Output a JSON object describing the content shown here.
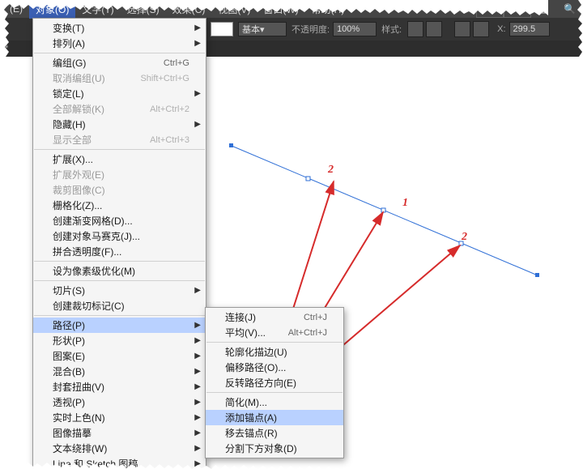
{
  "menubar": {
    "items": [
      {
        "label": "(E)"
      },
      {
        "label": "对象(O)"
      },
      {
        "label": "文字(T)"
      },
      {
        "label": "选择(S)"
      },
      {
        "label": "效果(C)"
      },
      {
        "label": "视图(V)"
      },
      {
        "label": "窗口(W)"
      },
      {
        "label": "帮助(H)"
      }
    ],
    "active_index": 1
  },
  "toolbar": {
    "basic_label": "基本",
    "opacity_label": "不透明度:",
    "opacity_value": "100%",
    "style_label": "样式:",
    "x_label": "X:",
    "x_value": "299.5"
  },
  "tabstrip": {
    "doc_label": "*"
  },
  "object_menu": [
    {
      "label": "变换(T)",
      "arrow": true
    },
    {
      "label": "排列(A)",
      "arrow": true
    },
    {
      "sep": true
    },
    {
      "label": "编组(G)",
      "shortcut": "Ctrl+G"
    },
    {
      "label": "取消编组(U)",
      "shortcut": "Shift+Ctrl+G",
      "disabled": true
    },
    {
      "label": "锁定(L)",
      "arrow": true
    },
    {
      "label": "全部解锁(K)",
      "shortcut": "Alt+Ctrl+2",
      "disabled": true
    },
    {
      "label": "隐藏(H)",
      "arrow": true
    },
    {
      "label": "显示全部",
      "shortcut": "Alt+Ctrl+3",
      "disabled": true
    },
    {
      "sep": true
    },
    {
      "label": "扩展(X)..."
    },
    {
      "label": "扩展外观(E)",
      "disabled": true
    },
    {
      "label": "裁剪图像(C)",
      "disabled": true
    },
    {
      "label": "栅格化(Z)..."
    },
    {
      "label": "创建渐变网格(D)..."
    },
    {
      "label": "创建对象马赛克(J)..."
    },
    {
      "label": "拼合透明度(F)..."
    },
    {
      "sep": true
    },
    {
      "label": "设为像素级优化(M)"
    },
    {
      "sep": true
    },
    {
      "label": "切片(S)",
      "arrow": true
    },
    {
      "label": "创建裁切标记(C)"
    },
    {
      "sep": true
    },
    {
      "label": "路径(P)",
      "arrow": true,
      "highlight": true
    },
    {
      "label": "形状(P)",
      "arrow": true
    },
    {
      "label": "图案(E)",
      "arrow": true
    },
    {
      "label": "混合(B)",
      "arrow": true
    },
    {
      "label": "封套扭曲(V)",
      "arrow": true
    },
    {
      "label": "透视(P)",
      "arrow": true
    },
    {
      "label": "实时上色(N)",
      "arrow": true
    },
    {
      "label": "图像描摹",
      "arrow": true
    },
    {
      "label": "文本绕排(W)",
      "arrow": true
    },
    {
      "label": "Line 和 Sketch 图稿",
      "arrow": true
    }
  ],
  "path_submenu": [
    {
      "label": "连接(J)",
      "shortcut": "Ctrl+J"
    },
    {
      "label": "平均(V)...",
      "shortcut": "Alt+Ctrl+J"
    },
    {
      "sep": true
    },
    {
      "label": "轮廓化描边(U)"
    },
    {
      "label": "偏移路径(O)..."
    },
    {
      "label": "反转路径方向(E)"
    },
    {
      "sep": true
    },
    {
      "label": "简化(M)..."
    },
    {
      "label": "添加锚点(A)",
      "highlight": true
    },
    {
      "label": "移去锚点(R)"
    },
    {
      "label": "分割下方对象(D)"
    }
  ],
  "canvas": {
    "labels": {
      "p1": "1",
      "p2a": "2",
      "p2b": "2"
    }
  }
}
